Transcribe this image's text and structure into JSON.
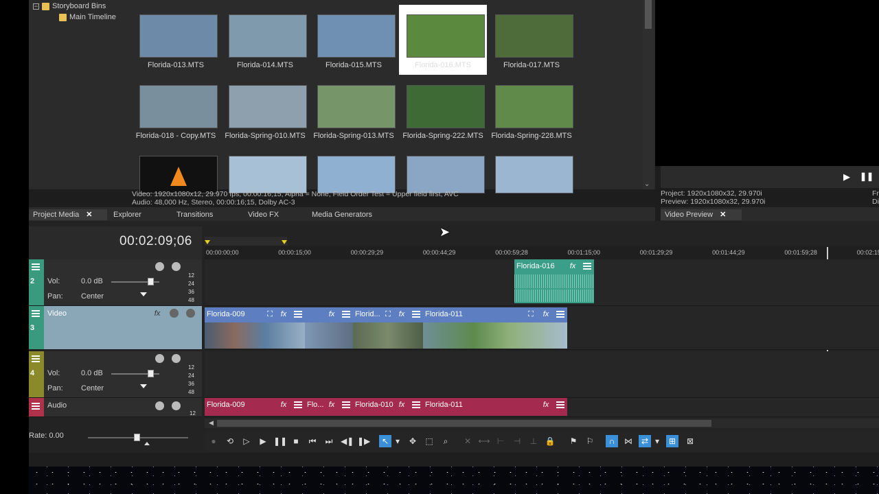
{
  "tree": {
    "root_label": "Storyboard Bins",
    "child_label": "Main Timeline"
  },
  "media": {
    "tiles": [
      {
        "label": "Florida-013.MTS",
        "color": "#6d8aa8",
        "selected": false
      },
      {
        "label": "Florida-014.MTS",
        "color": "#7e9aac",
        "selected": false
      },
      {
        "label": "Florida-015.MTS",
        "color": "#6f90b2",
        "selected": false
      },
      {
        "label": "Florida-016.MTS",
        "color": "#5b8a3f",
        "selected": true
      },
      {
        "label": "Florida-017.MTS",
        "color": "#4e6b3a",
        "selected": false
      },
      {
        "label": "Florida-018 - Copy.MTS",
        "color": "#7a8f9e",
        "selected": false
      },
      {
        "label": "Florida-Spring-010.MTS",
        "color": "#8ea0ad",
        "selected": false
      },
      {
        "label": "Florida-Spring-013.MTS",
        "color": "#76966a",
        "selected": false
      },
      {
        "label": "Florida-Spring-222.MTS",
        "color": "#3e6a36",
        "selected": false
      },
      {
        "label": "Florida-Spring-228.MTS",
        "color": "#5f8a4a",
        "selected": false
      },
      {
        "label": "",
        "color": "#111111",
        "selected": false
      },
      {
        "label": "",
        "color": "#a8c0d6",
        "selected": false
      },
      {
        "label": "",
        "color": "#8fb0d0",
        "selected": false
      },
      {
        "label": "",
        "color": "#8aa6c4",
        "selected": false
      },
      {
        "label": "",
        "color": "#9bb6d0",
        "selected": false
      }
    ],
    "info_line1": "Video: 1920x1080x12, 29.970 fps, 00:00:16;15, Alpha = None, Field Order Test = Upper field first, AVC",
    "info_line2": "Audio: 48,000 Hz, Stereo, 00:00:16;15, Dolby AC-3"
  },
  "tabs": {
    "project_media": "Project Media",
    "close_symbol": "✕",
    "explorer": "Explorer",
    "transitions": "Transitions",
    "video_fx": "Video FX",
    "media_generators": "Media Generators"
  },
  "preview": {
    "project_label": "Project:",
    "project_value": "1920x1080x32, 29.970i",
    "preview_label": "Preview:",
    "preview_value": "1920x1080x32, 29.970i",
    "right_fr": "Fr",
    "right_di": "Di",
    "tab_label": "Video Preview"
  },
  "timeline": {
    "time_code": "00:02:09;06",
    "ruler_marks": [
      "00:00:00;00",
      "00:00:15;00",
      "00:00:29;29",
      "00:00:44;29",
      "00:00:59;28",
      "00:01:15;00",
      "00:01:29;29",
      "00:01:44;29",
      "00:01:59;28",
      "00:02:15"
    ],
    "track2": {
      "number": "2",
      "vol_label": "Vol:",
      "vol_value": "0.0 dB",
      "pan_label": "Pan:",
      "pan_value": "Center",
      "meter": [
        "12",
        "24",
        "36",
        "48"
      ]
    },
    "track3": {
      "number": "3",
      "name": "Video"
    },
    "track4": {
      "number": "4",
      "vol_label": "Vol:",
      "vol_value": "0.0 dB",
      "pan_label": "Pan:",
      "pan_value": "Center",
      "meter": [
        "12",
        "24",
        "36",
        "48"
      ]
    },
    "track5": {
      "name": "Audio",
      "meter": "12"
    },
    "rate_label": "Rate: 0.00",
    "clips": {
      "audio_top": "Florida-016",
      "video_1": "Florida-009",
      "video_2": "Florid...",
      "video_3": "Florida-011",
      "audio_1": "Florida-009",
      "audio_2": "Flo...",
      "audio_3": "Florida-010",
      "audio_4": "Florida-011"
    }
  },
  "colors": {
    "track_audio_top": "#3e9e88",
    "track_video": "#3d9a82",
    "track_audio_olive": "#8a8a2a",
    "track_audio_red": "#b0324a",
    "clip_video": "#5d7fc1",
    "clip_audio_green": "#3fa08c",
    "clip_audio_red": "#a52a4f"
  },
  "icons": [
    "folder-icon",
    "play-icon",
    "pause-icon",
    "stop-icon",
    "loop-icon",
    "fx-icon",
    "menu-icon",
    "mute-icon",
    "solo-icon",
    "crop-icon",
    "snap-icon",
    "cursor-icon"
  ]
}
